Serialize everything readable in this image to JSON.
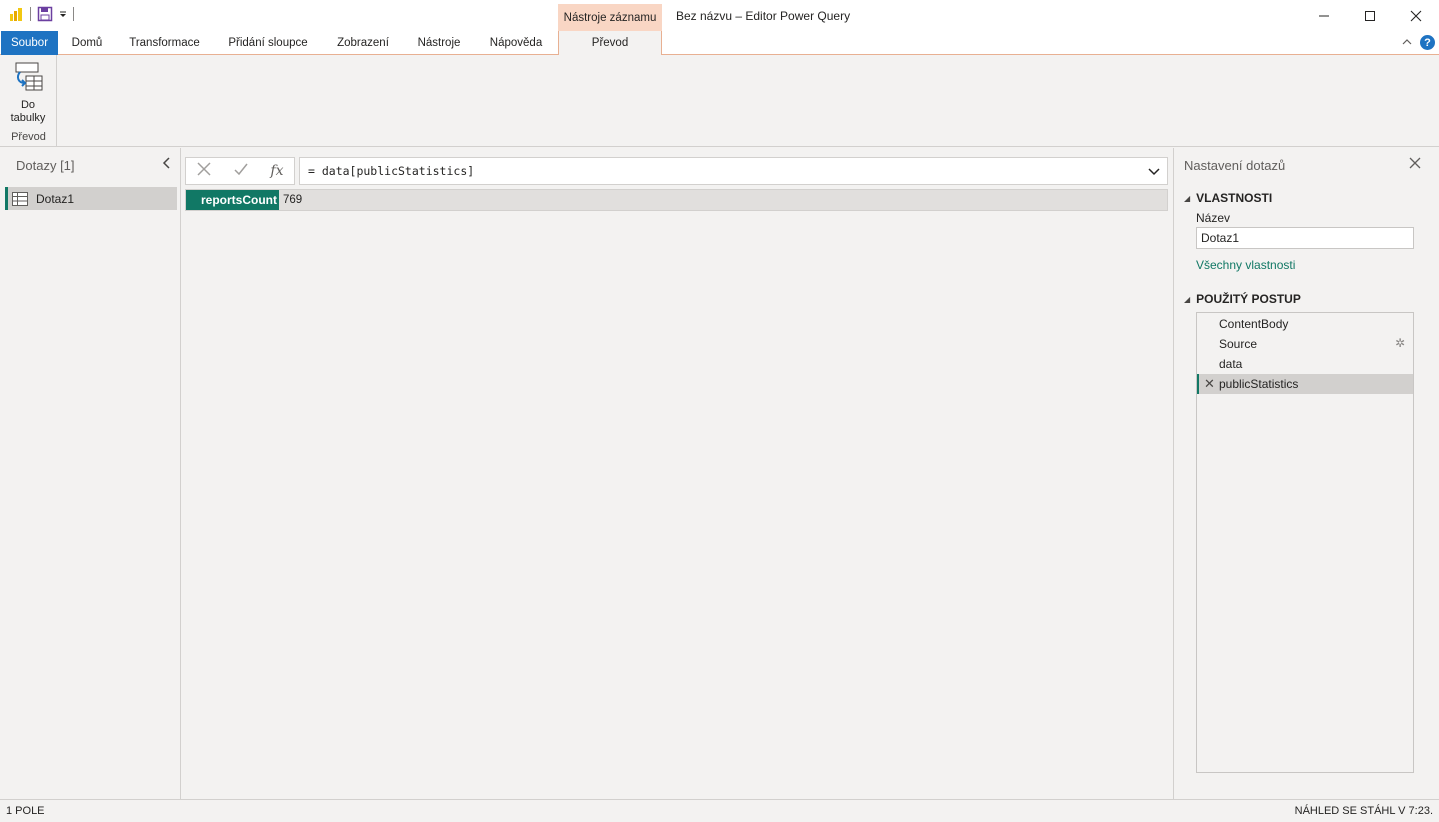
{
  "window": {
    "title": "Bez názvu – Editor Power Query",
    "context_tab_group": "Nástroje záznamu",
    "minimize": "—",
    "maximize": "☐",
    "close": "✕"
  },
  "ribbon": {
    "tabs": [
      "Soubor",
      "Domů",
      "Transformace",
      "Přidání sloupce",
      "Zobrazení",
      "Nástroje",
      "Nápověda",
      "Převod"
    ],
    "active_tab": "Převod",
    "help": "?",
    "collapse": "^",
    "groups": [
      {
        "label": "Převod",
        "buttons": [
          {
            "label_line1": "Do",
            "label_line2": "tabulky",
            "icon": "into-table-icon"
          }
        ]
      }
    ]
  },
  "queries_pane": {
    "title": "Dotazy [1]",
    "collapse": "‹",
    "items": [
      {
        "name": "Dotaz1",
        "icon": "table-icon"
      }
    ]
  },
  "formula_bar": {
    "cancel": "✕",
    "commit": "✓",
    "fx": "fx",
    "formula": "= data[publicStatistics]"
  },
  "record": {
    "rows": [
      {
        "key": "reportsCount",
        "value": "769"
      }
    ]
  },
  "settings_pane": {
    "title": "Nastavení dotazů",
    "close": "✕",
    "properties_header": "VLASTNOSTI",
    "name_label": "Název",
    "name_value": "Dotaz1",
    "all_properties_link": "Všechny vlastnosti",
    "steps_header": "POUŽITÝ POSTUP",
    "steps": [
      {
        "name": "ContentBody",
        "has_gear": false,
        "selected": false
      },
      {
        "name": "Source",
        "has_gear": true,
        "selected": false
      },
      {
        "name": "data",
        "has_gear": false,
        "selected": false
      },
      {
        "name": "publicStatistics",
        "has_gear": false,
        "selected": true
      }
    ],
    "gear": "✲",
    "delete": "✕"
  },
  "status_bar": {
    "left": "1 POLE",
    "right": "NÁHLED SE STÁHL V 7:23."
  },
  "colors": {
    "accent_green": "#117865",
    "file_tab_blue": "#1e73c2",
    "context_tab": "#f9d6c4"
  }
}
